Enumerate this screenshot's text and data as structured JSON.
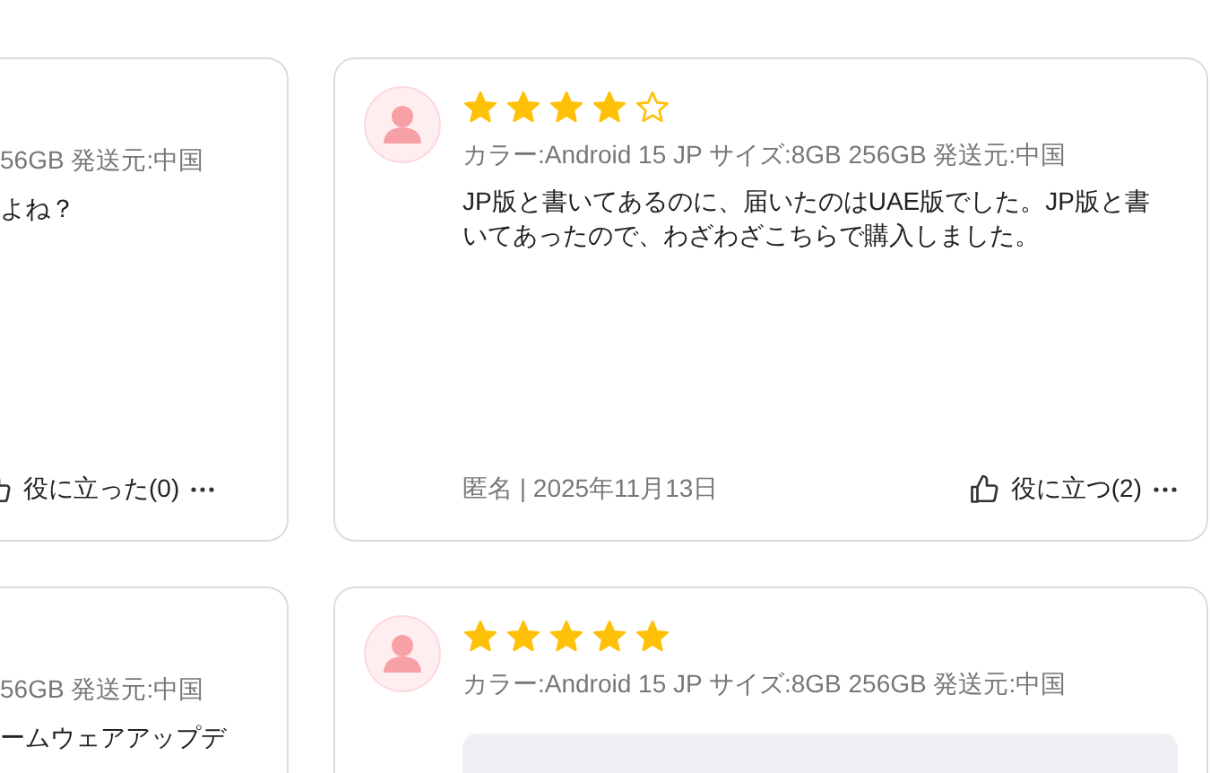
{
  "left_column": [
    {
      "meta": "56GB 発送元:中国",
      "body": "よね？",
      "helpful": "役に立った(0)"
    },
    {
      "meta": "56GB 発送元:中国",
      "body": "ームウェアアップデ"
    }
  ],
  "right_column": [
    {
      "stars": 4,
      "meta": "カラー:Android 15 JP サイズ:8GB 256GB 発送元:中国",
      "body": "JP版と書いてあるのに、届いたのはUAE版でした。JP版と書いてあったので、わざわざこちらで購入しました。",
      "author_date": "匿名 | 2025年11月13日",
      "helpful": "役に立つ(2)"
    },
    {
      "stars": 5,
      "meta": "カラー:Android 15 JP サイズ:8GB 256GB 発送元:中国",
      "has_reply": true
    }
  ]
}
